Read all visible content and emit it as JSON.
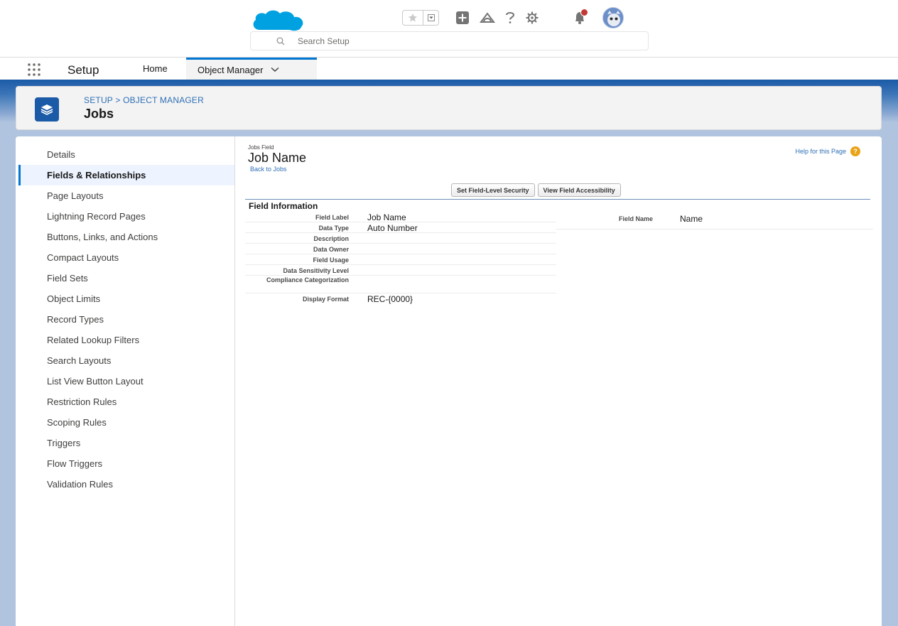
{
  "header": {
    "search_placeholder": "Search Setup",
    "icons": [
      "salesforce-cloud-logo",
      "favorite-star-icon",
      "favorites-dropdown-icon",
      "global-actions-plus-icon",
      "trailhead-guidance-icon",
      "help-question-icon",
      "setup-gear-icon",
      "notifications-bell-icon",
      "user-avatar"
    ]
  },
  "nav": {
    "app_name": "Setup",
    "tabs": [
      {
        "label": "Home"
      },
      {
        "label": "Object Manager"
      }
    ]
  },
  "page_header": {
    "breadcrumb": "SETUP > OBJECT MANAGER",
    "title": "Jobs"
  },
  "sidebar": {
    "items": [
      {
        "label": "Details"
      },
      {
        "label": "Fields & Relationships",
        "active": true
      },
      {
        "label": "Page Layouts"
      },
      {
        "label": "Lightning Record Pages"
      },
      {
        "label": "Buttons, Links, and Actions"
      },
      {
        "label": "Compact Layouts"
      },
      {
        "label": "Field Sets"
      },
      {
        "label": "Object Limits"
      },
      {
        "label": "Record Types"
      },
      {
        "label": "Related Lookup Filters"
      },
      {
        "label": "Search Layouts"
      },
      {
        "label": "List View Button Layout"
      },
      {
        "label": "Restriction Rules"
      },
      {
        "label": "Scoping Rules"
      },
      {
        "label": "Triggers"
      },
      {
        "label": "Flow Triggers"
      },
      {
        "label": "Validation Rules"
      }
    ]
  },
  "detail": {
    "object_label": "Jobs Field",
    "field_title": "Job Name",
    "back_link": "Back to Jobs",
    "help_link": "Help for this Page",
    "buttons": {
      "set_fls": "Set Field-Level Security",
      "view_access": "View Field Accessibility"
    },
    "section_title": "Field Information",
    "fields": [
      {
        "label": "Field Label",
        "value": "Job Name"
      },
      {
        "label": "Data Type",
        "value": "Auto Number"
      },
      {
        "label": "Description",
        "value": ""
      },
      {
        "label": "Data Owner",
        "value": ""
      },
      {
        "label": "Field Usage",
        "value": ""
      },
      {
        "label": "Data Sensitivity Level",
        "value": ""
      },
      {
        "label": "Compliance Categorization",
        "value": ""
      },
      {
        "label": "Display Format",
        "value": "REC-{0000}"
      }
    ],
    "right_field": {
      "label": "Field Name",
      "value": "Name"
    }
  },
  "colors": {
    "brand_blue": "#0176d3",
    "link_blue": "#2e6fb5",
    "background_blue": "#b0c4df",
    "notification_red": "#c23934",
    "help_orange": "#e8a317"
  }
}
